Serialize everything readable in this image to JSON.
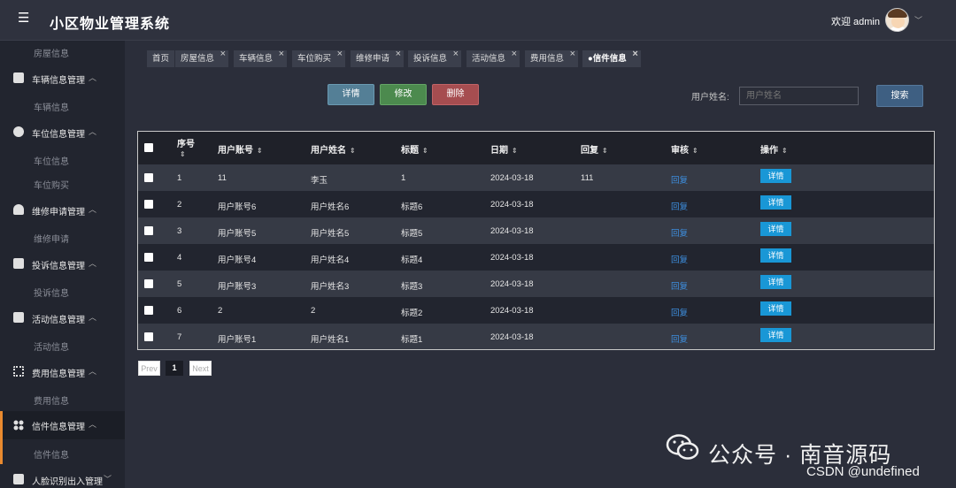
{
  "header": {
    "app_title": "小区物业管理系统",
    "welcome": "欢迎 admin",
    "menu_icon": "hamburger-icon",
    "caret_icon": "chevron-down-icon"
  },
  "sidebar": {
    "groups": [
      {
        "label": "车辆信息管理",
        "icon": "car-icon",
        "sub": [
          "车辆信息"
        ]
      },
      {
        "label": "车位信息管理",
        "icon": "parking-icon",
        "sub": [
          "车位信息",
          "车位购买"
        ]
      },
      {
        "label": "维修申请管理",
        "icon": "repair-icon",
        "sub": [
          "维修申请"
        ]
      },
      {
        "label": "投诉信息管理",
        "icon": "complaint-icon",
        "sub": [
          "投诉信息"
        ]
      },
      {
        "label": "活动信息管理",
        "icon": "activity-icon",
        "sub": [
          "活动信息"
        ]
      },
      {
        "label": "费用信息管理",
        "icon": "fee-icon",
        "sub": [
          "费用信息"
        ]
      },
      {
        "label": "信件信息管理",
        "icon": "letter-icon",
        "sub": [
          "信件信息"
        ]
      },
      {
        "label": "人脸识别出入管理",
        "icon": "face-icon",
        "sub": []
      }
    ],
    "top_sub": "房屋信息",
    "active_accent": "#e98a2f"
  },
  "tabs": [
    {
      "label": "首页",
      "closable": false
    },
    {
      "label": "房屋信息",
      "closable": true
    },
    {
      "label": "车辆信息",
      "closable": true
    },
    {
      "label": "车位购买",
      "closable": true
    },
    {
      "label": "维修申请",
      "closable": true
    },
    {
      "label": "投诉信息",
      "closable": true
    },
    {
      "label": "活动信息",
      "closable": true
    },
    {
      "label": "费用信息",
      "closable": true
    },
    {
      "label": "●信件信息",
      "closable": true
    }
  ],
  "toolbar": {
    "detail": "详情",
    "edit": "修改",
    "delete": "删除",
    "search_label": "用户姓名:",
    "search_placeholder": "用户姓名",
    "search_button": "搜索"
  },
  "table": {
    "headers": [
      "序号",
      "用户账号",
      "用户姓名",
      "标题",
      "日期",
      "回复",
      "审核",
      "操作"
    ],
    "rows": [
      {
        "seq": "1",
        "account": "11",
        "name": "李玉",
        "title": "1",
        "date": "2024-03-18",
        "reply": "111",
        "audit": "回复",
        "op": "详情"
      },
      {
        "seq": "2",
        "account": "用户账号6",
        "name": "用户姓名6",
        "title": "标题6",
        "date": "2024-03-18",
        "reply": "",
        "audit": "回复",
        "op": "详情"
      },
      {
        "seq": "3",
        "account": "用户账号5",
        "name": "用户姓名5",
        "title": "标题5",
        "date": "2024-03-18",
        "reply": "",
        "audit": "回复",
        "op": "详情"
      },
      {
        "seq": "4",
        "account": "用户账号4",
        "name": "用户姓名4",
        "title": "标题4",
        "date": "2024-03-18",
        "reply": "",
        "audit": "回复",
        "op": "详情"
      },
      {
        "seq": "5",
        "account": "用户账号3",
        "name": "用户姓名3",
        "title": "标题3",
        "date": "2024-03-18",
        "reply": "",
        "audit": "回复",
        "op": "详情"
      },
      {
        "seq": "6",
        "account": "2",
        "name": "2",
        "title": "标题2",
        "date": "2024-03-18",
        "reply": "",
        "audit": "回复",
        "op": "详情"
      },
      {
        "seq": "7",
        "account": "用户账号1",
        "name": "用户姓名1",
        "title": "标题1",
        "date": "2024-03-18",
        "reply": "",
        "audit": "回复",
        "op": "详情"
      }
    ]
  },
  "pager": {
    "prev": "Prev",
    "current": "1",
    "next": "Next"
  },
  "watermark": {
    "text": "公众号 · 南音源码",
    "csdn": "CSDN @undefined"
  }
}
